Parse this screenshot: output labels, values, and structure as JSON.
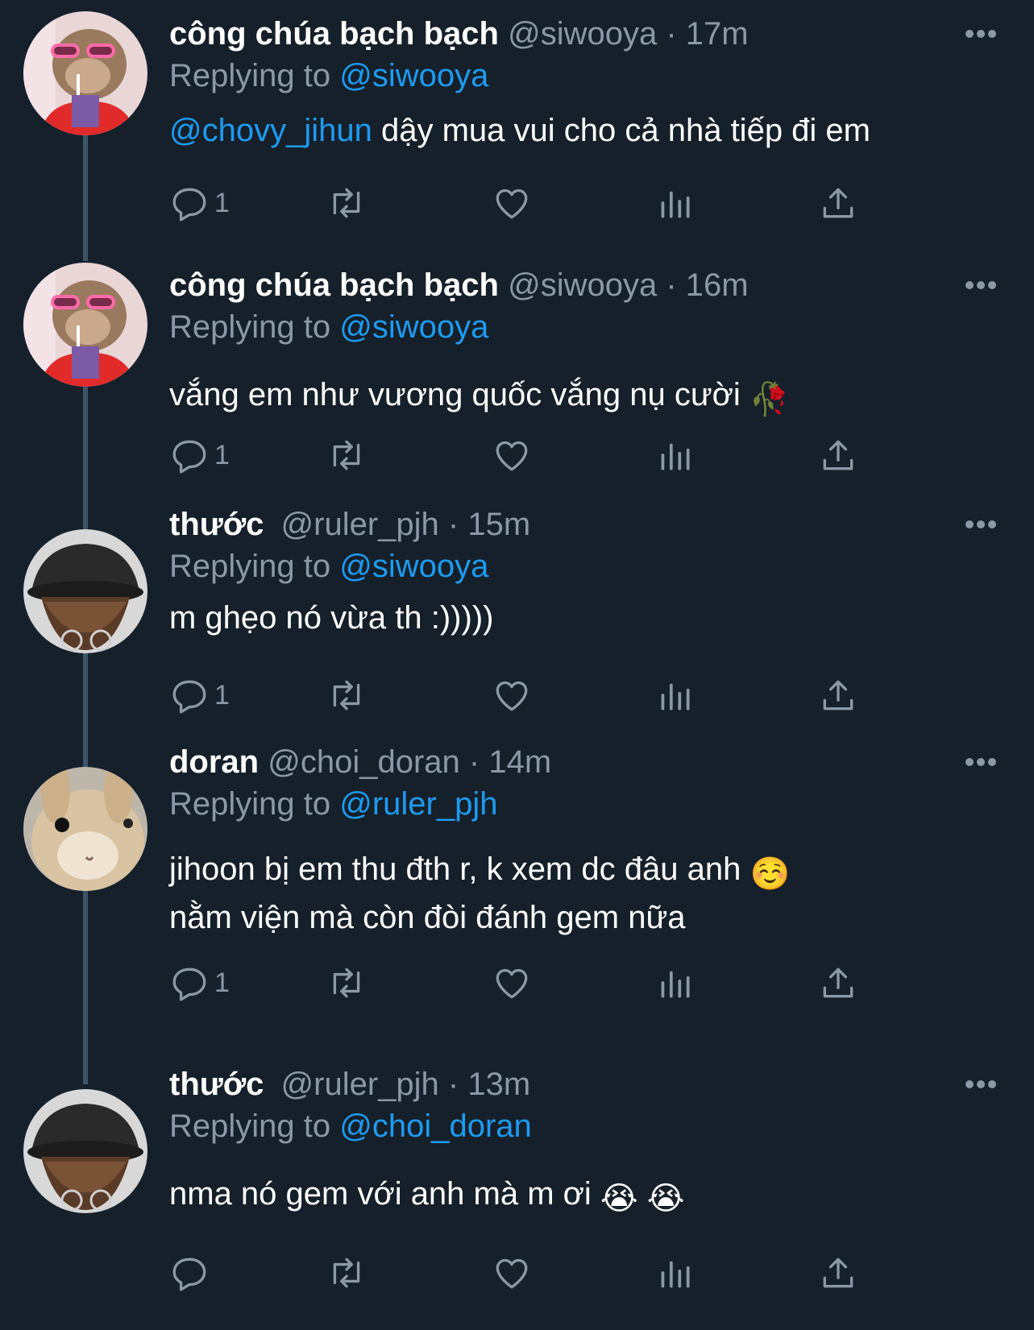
{
  "tweets": [
    {
      "name": "công chúa bạch bạch",
      "handle": "@siwooya",
      "time": "· 17m",
      "replying_prefix": "Replying to",
      "replying_to": "@siwooya",
      "body_mention": "@chovy_jihun",
      "body": " dậy mua vui cho cả nhà tiếp đi em",
      "reply_count": "1"
    },
    {
      "name": "công chúa bạch bạch",
      "handle": "@siwooya",
      "time": "· 16m",
      "replying_prefix": "Replying to",
      "replying_to": "@siwooya",
      "body": "vắng em như vương quốc vắng nụ cười",
      "body_emoji": "🥀",
      "reply_count": "1"
    },
    {
      "name": "thước",
      "handle": "@ruler_pjh",
      "time": "· 15m",
      "replying_prefix": "Replying to",
      "replying_to": "@siwooya",
      "body": "m ghẹo nó vừa th :)))))",
      "reply_count": "1"
    },
    {
      "name": "doran",
      "handle": "@choi_doran",
      "time": "· 14m",
      "replying_prefix": "Replying to",
      "replying_to": "@ruler_pjh",
      "body_line1": "jihoon bị em thu đth r, k xem dc đâu anh",
      "body_emoji": "☺️",
      "body_line2": "nằm viện mà còn đòi đánh gem nữa",
      "reply_count": "1"
    },
    {
      "name": "thước",
      "handle": "@ruler_pjh",
      "time": "· 13m",
      "replying_prefix": "Replying to",
      "replying_to": "@choi_doran",
      "body": "nma nó gem với anh mà m ơi",
      "body_emoji": "😭 😭",
      "reply_count": ""
    }
  ],
  "icons": [
    "reply-icon",
    "retweet-icon",
    "like-icon",
    "views-icon",
    "share-icon",
    "more-icon"
  ],
  "colors": {
    "background": "#15202b",
    "text": "#ffffff",
    "muted": "#8b98a5",
    "link": "#1d9bf0",
    "thread": "#3d5466"
  }
}
